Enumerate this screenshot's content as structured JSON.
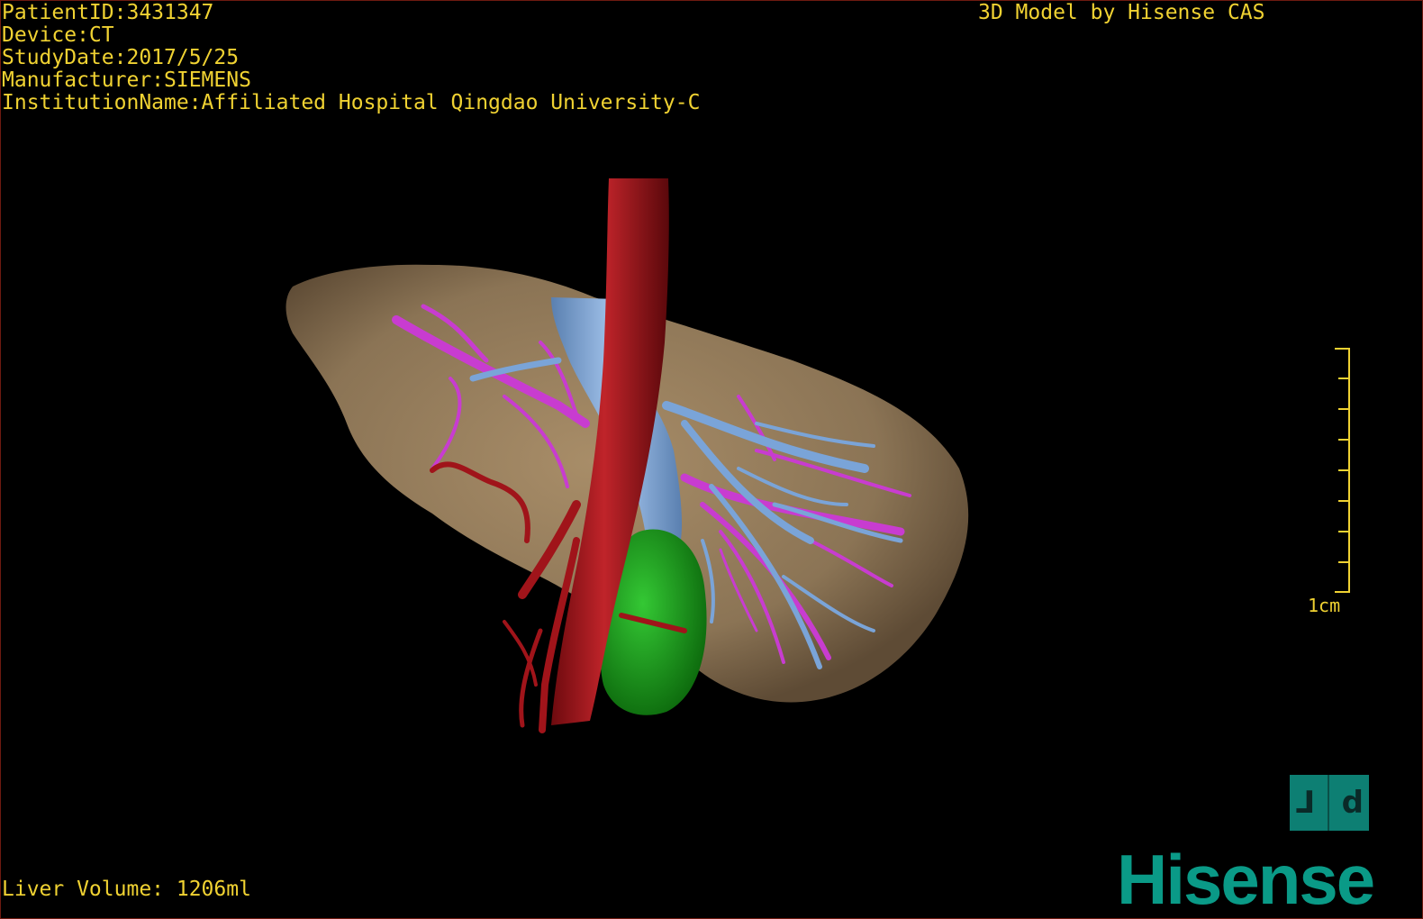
{
  "header": {
    "patient_id": "PatientID:3431347",
    "device": "Device:CT",
    "study_date": "StudyDate:2017/5/25",
    "manufacturer": "Manufacturer:SIEMENS",
    "institution": "InstitutionName:Affiliated Hospital Qingdao University-C",
    "title": "3D Model by Hisense CAS"
  },
  "footer": {
    "liver_volume": "Liver Volume: 1206ml"
  },
  "scale_bar": {
    "label": "1cm",
    "ticks": 9
  },
  "view_cube": {
    "left_glyph": "⅃",
    "right_glyph": "d"
  },
  "logo": {
    "text": "Hisense"
  },
  "colors": {
    "hud_text": "#f0d232",
    "liver": "#8b7455",
    "aorta": "#a0141a",
    "portal_vein": "#7aa4d8",
    "hepatic_vein": "#c83cd0",
    "gallbladder": "#1aa01a",
    "artery": "#b0141a",
    "brand": "#0a9a87"
  }
}
